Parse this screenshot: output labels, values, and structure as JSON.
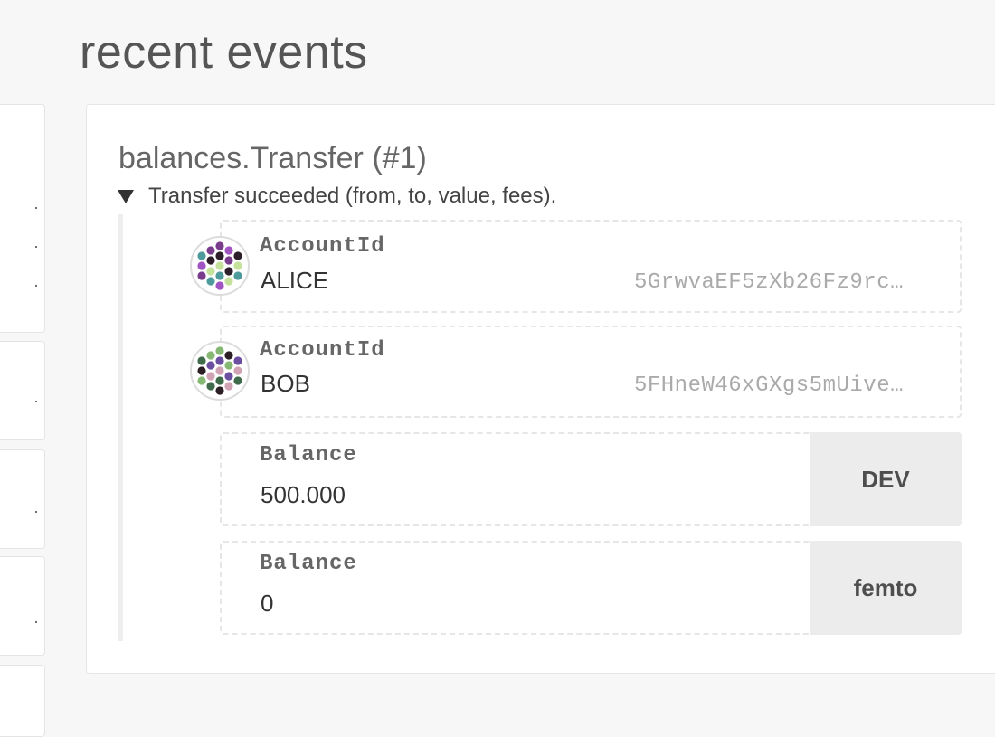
{
  "page": {
    "title": "recent events"
  },
  "left_column": {
    "cards": [
      {
        "dots": [
          "·",
          "·",
          "·"
        ]
      },
      {
        "dots": [
          "·"
        ]
      },
      {
        "dots": [
          "·"
        ]
      },
      {
        "dots": [
          "·"
        ]
      },
      {
        "dots": []
      }
    ]
  },
  "event": {
    "title": "balances.Transfer (#1)",
    "summary": "Transfer succeeded (from, to, value, fees).",
    "params": [
      {
        "type": "AccountId",
        "name": "ALICE",
        "address": "5GrwvaEF5zXb26Fz9rc…",
        "avatar_colors": [
          "#7a3c8c",
          "#c5e29a",
          "#a154c1",
          "#2d1f2a",
          "#4f9b9b"
        ]
      },
      {
        "type": "AccountId",
        "name": "BOB",
        "address": "5FHneW46xGXgs5mUive…",
        "avatar_colors": [
          "#3f6b4a",
          "#85b872",
          "#d0a2b4",
          "#2b1f25",
          "#6b4ea0"
        ]
      },
      {
        "type": "Balance",
        "value": "500.000",
        "unit": "DEV"
      },
      {
        "type": "Balance",
        "value": "0",
        "unit": "femto"
      }
    ]
  }
}
